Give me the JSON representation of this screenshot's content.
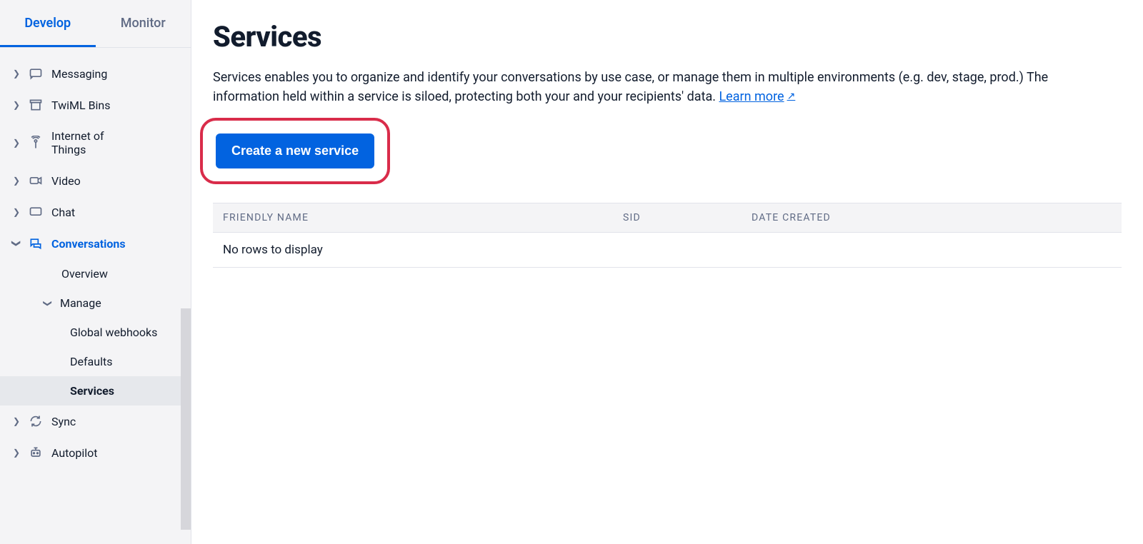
{
  "sidebar": {
    "tabs": {
      "develop": "Develop",
      "monitor": "Monitor"
    },
    "items": {
      "messaging": "Messaging",
      "twiml": "TwiML Bins",
      "iot": "Internet of Things",
      "video": "Video",
      "chat": "Chat",
      "conversations": "Conversations",
      "sync": "Sync",
      "autopilot": "Autopilot"
    },
    "conv_children": {
      "overview": "Overview",
      "manage": "Manage",
      "global_webhooks": "Global webhooks",
      "defaults": "Defaults",
      "services": "Services"
    }
  },
  "main": {
    "title": "Services",
    "description": "Services enables you to organize and identify your conversations by use case, or manage them in multiple environments (e.g. dev, stage, prod.) The information held within a service is siloed, protecting both your and your recipients' data.  ",
    "learn_more": "Learn more",
    "create_button": "Create a new service",
    "columns": {
      "name": "FRIENDLY NAME",
      "sid": "SID",
      "date": "DATE CREATED"
    },
    "empty": "No rows to display"
  }
}
